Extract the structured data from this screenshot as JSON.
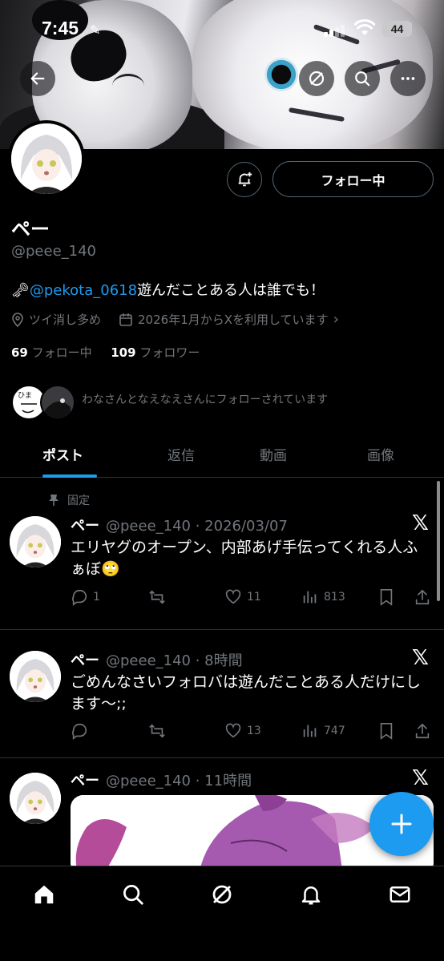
{
  "status_bar": {
    "time": "7:45",
    "battery": "44"
  },
  "profile": {
    "name": "ペー",
    "handle": "@peee_140",
    "bio_prefix_icon": "key-icon",
    "bio_mention": "@pekota_0618",
    "bio_text": "遊んだことある人は誰でも！",
    "location": "ツイ消し多め",
    "joined": "2026年1月からXを利用しています",
    "following_count": "69",
    "following_label": "フォロー中",
    "followers_count": "109",
    "followers_label": "フォロワー",
    "mutuals_text": "わなさんとなえなえさんにフォローされています",
    "follow_button": "フォロー中"
  },
  "tabs": [
    "ポスト",
    "返信",
    "動画",
    "画像"
  ],
  "pinned_label": "固定",
  "posts": [
    {
      "name": "ペー",
      "meta": "@peee_140 · 2026/03/07",
      "text": "エリヤグのオープン、内部あげ手伝ってくれる人ふぁぼ🙄",
      "replies": "1",
      "reposts": "",
      "likes": "11",
      "views": "813"
    },
    {
      "name": "ペー",
      "meta": "@peee_140 · 8時間",
      "text": "ごめんなさいフォロバは遊んだことある人だけにします〜;;",
      "replies": "",
      "reposts": "",
      "likes": "13",
      "views": "747"
    },
    {
      "name": "ペー",
      "meta": "@peee_140 · 11時間"
    }
  ],
  "colors": {
    "accent": "#1d9bf0",
    "text": "#e7e9ea",
    "muted": "#71767b",
    "border": "#2f3336"
  }
}
